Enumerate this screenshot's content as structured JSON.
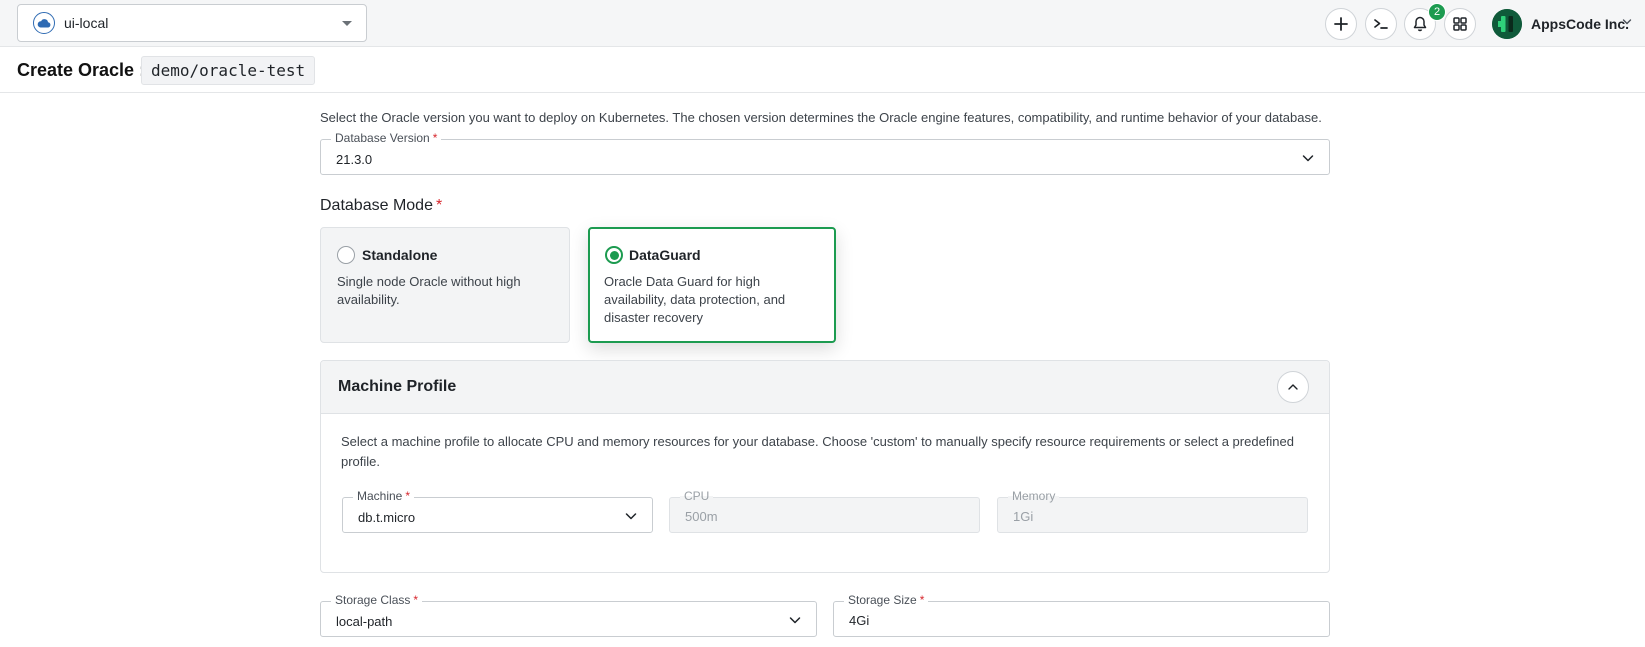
{
  "topbar": {
    "cluster_name": "ui-local",
    "notification_count": "2",
    "org_name": "AppsCode Inc."
  },
  "header": {
    "title": "Create Oracle :",
    "resource": "demo/oracle-test"
  },
  "version": {
    "description": "Select the Oracle version you want to deploy on Kubernetes. The chosen version determines the Oracle engine features, compatibility, and runtime behavior of your database.",
    "label": "Database Version",
    "value": "21.3.0"
  },
  "mode": {
    "title": "Database Mode",
    "options": [
      {
        "name": "Standalone",
        "description": "Single node Oracle without high availability.",
        "selected": false
      },
      {
        "name": "DataGuard",
        "description": "Oracle Data Guard for high availability, data protection, and disaster recovery",
        "selected": true
      }
    ]
  },
  "machine_profile": {
    "title": "Machine Profile",
    "description": "Select a machine profile to allocate CPU and memory resources for your database. Choose 'custom' to manually specify resource requirements or select a predefined profile.",
    "machine_label": "Machine",
    "machine_value": "db.t.micro",
    "cpu_label": "CPU",
    "cpu_value": "500m",
    "memory_label": "Memory",
    "memory_value": "1Gi"
  },
  "storage": {
    "class_label": "Storage Class",
    "class_value": "local-path",
    "size_label": "Storage Size",
    "size_value": "4Gi"
  },
  "required_mark": "*",
  "colors": {
    "accent": "#1c9b50",
    "required": "#d7262d"
  }
}
